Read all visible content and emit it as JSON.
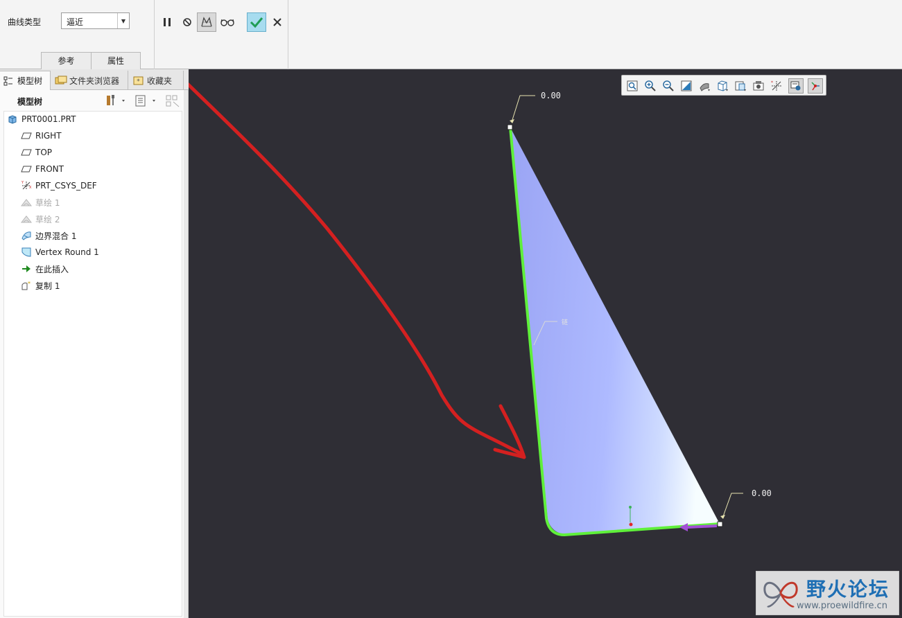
{
  "dashboard": {
    "curve_type_label": "曲线类型",
    "curve_type_value": "逼近",
    "tabs": [
      {
        "label": "参考"
      },
      {
        "label": "属性"
      }
    ],
    "tools": [
      "pause-icon",
      "no-preview-icon",
      "check-geometry-icon",
      "verify-glasses-icon",
      "checkmark-icon",
      "close-icon"
    ],
    "colors": {
      "ok": "#1f9d55",
      "ok_bg": "#a7dcef"
    }
  },
  "navigator": {
    "tabs": [
      {
        "label": "模型树",
        "icon": "model-tree-icon"
      },
      {
        "label": "文件夹浏览器",
        "icon": "folder-browser-icon"
      },
      {
        "label": "收藏夹",
        "icon": "favorites-icon"
      }
    ],
    "tree_title": "模型树",
    "items": [
      {
        "label": "PRT0001.PRT",
        "icon": "part-icon",
        "dim": false
      },
      {
        "label": "RIGHT",
        "icon": "datum-plane-icon",
        "dim": false
      },
      {
        "label": "TOP",
        "icon": "datum-plane-icon",
        "dim": false
      },
      {
        "label": "FRONT",
        "icon": "datum-plane-icon",
        "dim": false
      },
      {
        "label": "PRT_CSYS_DEF",
        "icon": "csys-icon",
        "dim": false
      },
      {
        "label": "草绘 1",
        "icon": "sketch-icon",
        "dim": true
      },
      {
        "label": "草绘 2",
        "icon": "sketch-icon",
        "dim": true
      },
      {
        "label": "边界混合 1",
        "icon": "boundary-blend-icon",
        "dim": false
      },
      {
        "label": "Vertex Round 1",
        "icon": "vertex-round-icon",
        "dim": false
      },
      {
        "label": "在此插入",
        "icon": "insert-here-arrow-icon",
        "dim": false
      },
      {
        "label": "复制 1",
        "icon": "copy-surface-icon",
        "dim": false
      }
    ]
  },
  "graphics": {
    "view_tools": [
      "refit-icon",
      "zoom-in-icon",
      "zoom-out-icon",
      "repaint-icon",
      "display-style-icon",
      "saved-views-icon",
      "view-manager-icon",
      "perspective-icon",
      "datum-display-icon",
      "annotation-display-icon",
      "spin-center-icon"
    ],
    "annotations": {
      "top_value": "0.00",
      "bottom_value": "0.00",
      "edge_label": "链"
    },
    "colors": {
      "background": "#2f2e35",
      "surface": "#a8b4ff",
      "edge": "#5ff03a",
      "arrow": "#a24fd6",
      "red_annotation": "#d42020"
    }
  },
  "watermark": {
    "title": "野火论坛",
    "url": "www.proewildfire.cn"
  }
}
